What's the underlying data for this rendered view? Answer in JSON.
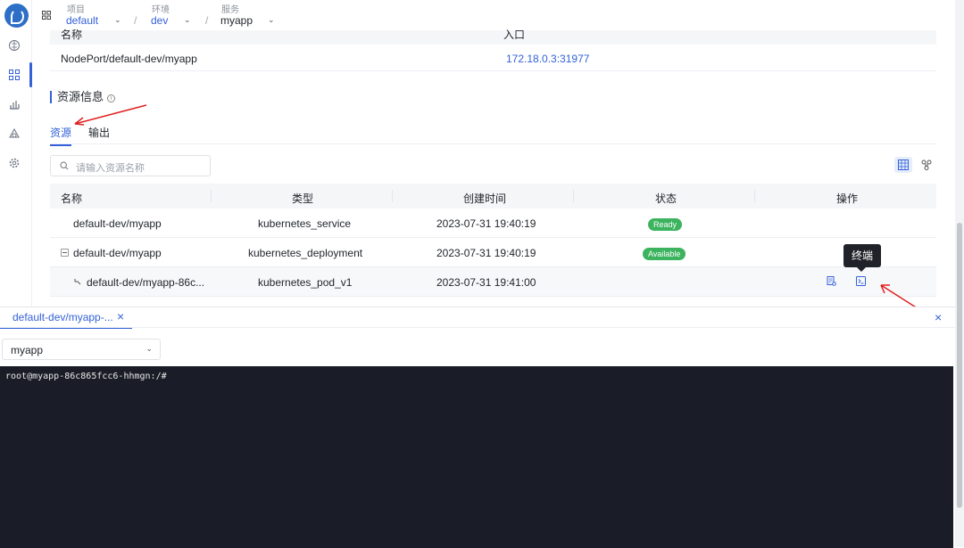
{
  "topbar": {
    "project": {
      "label": "项目",
      "value": "default"
    },
    "env": {
      "label": "环境",
      "value": "dev"
    },
    "service": {
      "label": "服务",
      "value": "myapp"
    },
    "separator": "/"
  },
  "entry": {
    "headers": [
      "名称",
      "入口"
    ],
    "row": {
      "name": "NodePort/default-dev/myapp",
      "entry": "172.18.0.3:31977"
    }
  },
  "section": {
    "title": "资源信息",
    "info_icon": "i"
  },
  "tabs": [
    {
      "label": "资源"
    },
    {
      "label": "输出"
    }
  ],
  "search": {
    "placeholder": "请输入资源名称"
  },
  "resources": {
    "headers": [
      "名称",
      "类型",
      "创建时间",
      "状态",
      "操作"
    ],
    "rows": [
      {
        "name": "default-dev/myapp",
        "type": "kubernetes_service",
        "created": "2023-07-31 19:40:19",
        "status": "Ready"
      },
      {
        "name": "default-dev/myapp",
        "type": "kubernetes_deployment",
        "created": "2023-07-31 19:40:19",
        "status": "Available"
      },
      {
        "name": "default-dev/myapp-86c...",
        "type": "kubernetes_pod_v1",
        "created": "2023-07-31 19:41:00",
        "status": ""
      }
    ]
  },
  "tooltip": {
    "text": "终端"
  },
  "panel": {
    "tab_label": "default-dev/myapp-...",
    "close": "×",
    "container_select": "myapp",
    "terminal_prompt": "root@myapp-86c865fcc6-hhmgn:/#"
  },
  "colors": {
    "accent": "#3461d9",
    "badge": "#3cb35e",
    "terminal_bg": "#1a1d27"
  }
}
